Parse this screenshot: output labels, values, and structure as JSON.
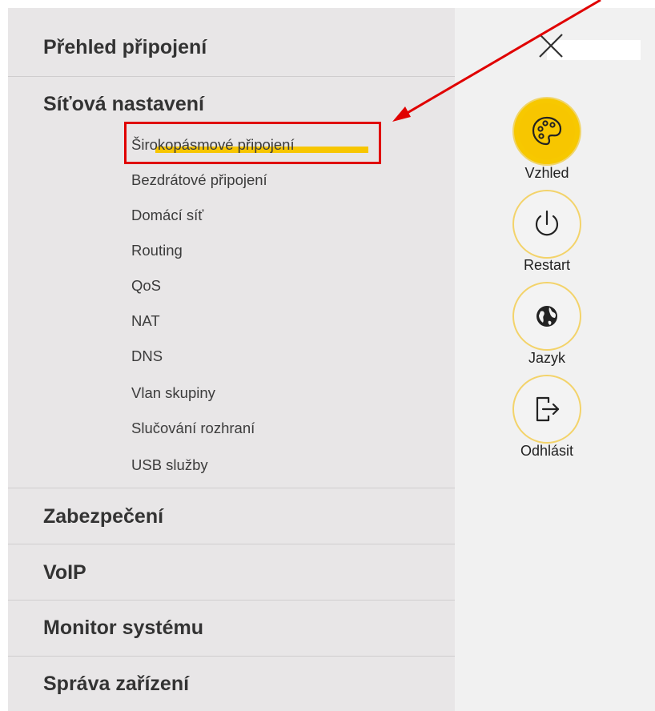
{
  "menu": {
    "sections": [
      {
        "title": "Přehled připojení"
      },
      {
        "title": "Síťová nastavení"
      },
      {
        "title": "Zabezpečení"
      },
      {
        "title": "VoIP"
      },
      {
        "title": "Monitor systému"
      },
      {
        "title": "Správa zařízení"
      }
    ],
    "network_items": [
      "Širokopásmové připojení",
      "Bezdrátové připojení",
      "Domácí síť",
      "Routing",
      "QoS",
      "NAT",
      "DNS",
      "Vlan skupiny",
      "Slučování rozhraní",
      "USB služby"
    ],
    "active_item": "Širokopásmové připojení"
  },
  "actions": {
    "appearance_label": "Vzhled",
    "restart_label": "Restart",
    "language_label": "Jazyk",
    "logout_label": "Odhlásit"
  },
  "colors": {
    "accent": "#f7c600",
    "annotation": "#e00000"
  },
  "icons": {
    "close": "close-icon",
    "appearance": "palette-icon",
    "restart": "power-icon",
    "language": "globe-icon",
    "logout": "logout-icon"
  }
}
